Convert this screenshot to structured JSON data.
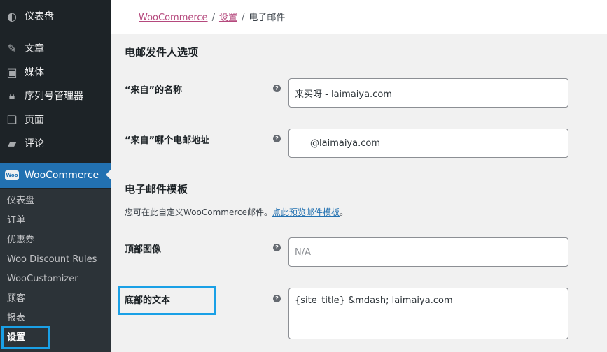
{
  "sidebar": {
    "items": [
      {
        "label": "仪表盘",
        "icon": "dashboard-icon"
      },
      {
        "label": "文章",
        "icon": "pin-icon"
      },
      {
        "label": "媒体",
        "icon": "media-icon"
      },
      {
        "label": "序列号管理器",
        "icon": "lock-icon"
      },
      {
        "label": "页面",
        "icon": "page-icon"
      },
      {
        "label": "评论",
        "icon": "comment-icon"
      }
    ],
    "active": {
      "label": "WooCommerce",
      "icon": "woo-icon",
      "icon_text": "Woo"
    },
    "submenu": [
      {
        "label": "仪表盘"
      },
      {
        "label": "订单"
      },
      {
        "label": "优惠券"
      },
      {
        "label": "Woo Discount Rules"
      },
      {
        "label": "WooCustomizer"
      },
      {
        "label": "顾客"
      },
      {
        "label": "报表"
      },
      {
        "label": "设置"
      }
    ],
    "colors": {
      "bg": "#1d2327",
      "active": "#2271b1",
      "highlight": "#1aa0e6"
    }
  },
  "breadcrumb": {
    "root": "WooCommerce",
    "parent": "设置",
    "current": "电子邮件",
    "separator": "/"
  },
  "sender_section": {
    "title": "电邮发件人选项",
    "from_name": {
      "label": "“来自”的名称",
      "value": "来买呀 - laimaiya.com"
    },
    "from_address": {
      "label": "“来自”哪个电邮地址",
      "value": "@laimaiya.com"
    }
  },
  "template_section": {
    "title": "电子邮件模板",
    "desc_text": "您可在此自定义WooCommerce邮件。",
    "desc_link": "点此预览邮件模板",
    "desc_end": "。",
    "header_image": {
      "label": "顶部图像",
      "placeholder": "N/A"
    },
    "footer_text": {
      "label": "底部的文本",
      "value": "{site_title} &mdash; laimaiya.com"
    }
  },
  "help_glyph": "?"
}
